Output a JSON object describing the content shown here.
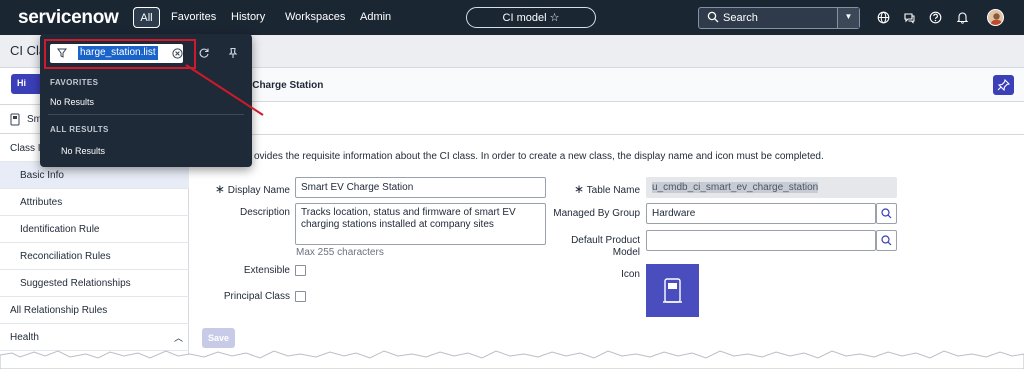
{
  "nav": {
    "logo_text": "servicenow",
    "all": "All",
    "favorites": "Favorites",
    "history": "History",
    "workspaces": "Workspaces",
    "admin": "Admin",
    "context_pill": "CI model ☆",
    "search_placeholder": "Search",
    "icons": [
      "globe-icon",
      "chat-icon",
      "help-icon",
      "bell-icon"
    ]
  },
  "subheader": {
    "title": "CI Cla"
  },
  "left": {
    "hi_button": "Hi",
    "smart_label": "Sm",
    "class_info": "Class In",
    "items": [
      "Basic Info",
      "Attributes",
      "Identification Rule",
      "Reconciliation Rules",
      "Suggested Relationships"
    ],
    "all_relationship": "All Relationship Rules",
    "health": "Health"
  },
  "main": {
    "title": "t EV Charge Station",
    "description": "ovides the requisite information about the CI class. In order to create a new class, the display name and icon must be completed.",
    "display_name_label": "Display Name",
    "display_name_value": "Smart EV Charge Station",
    "description_label": "Description",
    "description_value": "Tracks location, status and firmware of smart EV charging stations installed at company sites",
    "max_chars": "Max 255 characters",
    "extensible_label": "Extensible",
    "principal_label": "Principal Class",
    "table_name_label": "Table Name",
    "table_name_value": "u_cmdb_ci_smart_ev_charge_station",
    "managed_by_label": "Managed By Group",
    "managed_by_value": "Hardware",
    "default_product_label_1": "Default Product",
    "default_product_label_2": "Model",
    "icon_label": "Icon",
    "save": "Save"
  },
  "popup": {
    "input_value": "harge_station.list",
    "favorites_header": "FAVORITES",
    "favorites_empty": "No Results",
    "all_header": "ALL RESULTS",
    "all_empty": "No Results"
  },
  "colors": {
    "nav_bg": "#1b2633",
    "accent": "#3b3fb8",
    "highlight_red": "#d0192a",
    "selection_blue": "#1a63c9"
  }
}
